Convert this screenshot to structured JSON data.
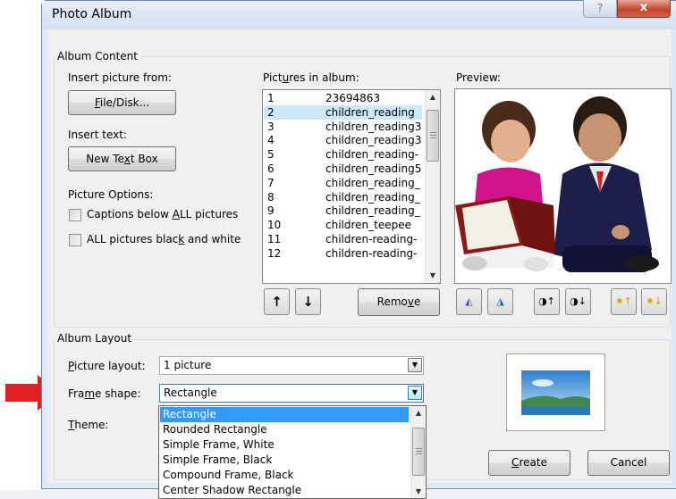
{
  "window": {
    "title": "Photo Album",
    "help_label": "?",
    "close_label": "x"
  },
  "album_content": {
    "legend": "Album Content",
    "insert_picture_label": "Insert picture from:",
    "file_disk_button": {
      "pre": "",
      "u": "F",
      "post": "ile/Disk..."
    },
    "insert_text_label": "Insert text:",
    "new_text_box_button": {
      "pre": "New Te",
      "u": "x",
      "post": "t Box"
    },
    "picture_options_label": "Picture Options:",
    "captions_option": {
      "pre": "Captions below ",
      "u": "A",
      "post": "LL pictures",
      "checked": false
    },
    "black_white_option": {
      "pre": "ALL pictures blac",
      "u": "k",
      "post": " and white",
      "checked": false
    }
  },
  "pictures_list": {
    "label": {
      "pre": "Pict",
      "u": "u",
      "post": "res in album:"
    },
    "items": [
      {
        "num": "1",
        "name": "23694863",
        "selected": false
      },
      {
        "num": "2",
        "name": "children_reading",
        "selected": true
      },
      {
        "num": "3",
        "name": "children_reading3",
        "selected": false
      },
      {
        "num": "4",
        "name": "children_reading3",
        "selected": false
      },
      {
        "num": "5",
        "name": "children_reading-",
        "selected": false
      },
      {
        "num": "6",
        "name": "children_reading5",
        "selected": false
      },
      {
        "num": "7",
        "name": "children_reading_",
        "selected": false
      },
      {
        "num": "8",
        "name": "children_reading_",
        "selected": false
      },
      {
        "num": "9",
        "name": "children_reading_",
        "selected": false
      },
      {
        "num": "10",
        "name": "children_teepee",
        "selected": false
      },
      {
        "num": "11",
        "name": "children-reading-",
        "selected": false
      },
      {
        "num": "12",
        "name": "children-reading-",
        "selected": false
      }
    ],
    "move_up_label": "↑",
    "move_down_label": "↓",
    "remove_button": {
      "pre": "Remo",
      "u": "v",
      "post": "e"
    }
  },
  "preview": {
    "label": "Preview:",
    "tools": [
      "rotate-left-icon",
      "rotate-right-icon",
      "contrast-up-icon",
      "contrast-down-icon",
      "brightness-up-icon",
      "brightness-down-icon"
    ]
  },
  "album_layout": {
    "legend": "Album Layout",
    "picture_layout": {
      "label_pre": "",
      "label_u": "P",
      "label_post": "icture layout:",
      "value": "1 picture"
    },
    "frame_shape": {
      "label_pre": "Fra",
      "label_u": "m",
      "label_post": "e shape:",
      "value": "Rectangle"
    },
    "theme": {
      "label_pre": "",
      "label_u": "T",
      "label_post": "heme:"
    },
    "frame_options": [
      "Rectangle",
      "Rounded Rectangle",
      "Simple Frame, White",
      "Simple Frame, Black",
      "Compound Frame, Black",
      "Center Shadow Rectangle"
    ],
    "selected_frame_option": 0
  },
  "footer": {
    "create_button": {
      "pre": "",
      "u": "C",
      "post": "reate"
    },
    "cancel_button": "Cancel"
  },
  "colors": {
    "annotation_arrow": "#e02020",
    "selection": "#3399ff",
    "list_selection": "#cde8fb"
  }
}
